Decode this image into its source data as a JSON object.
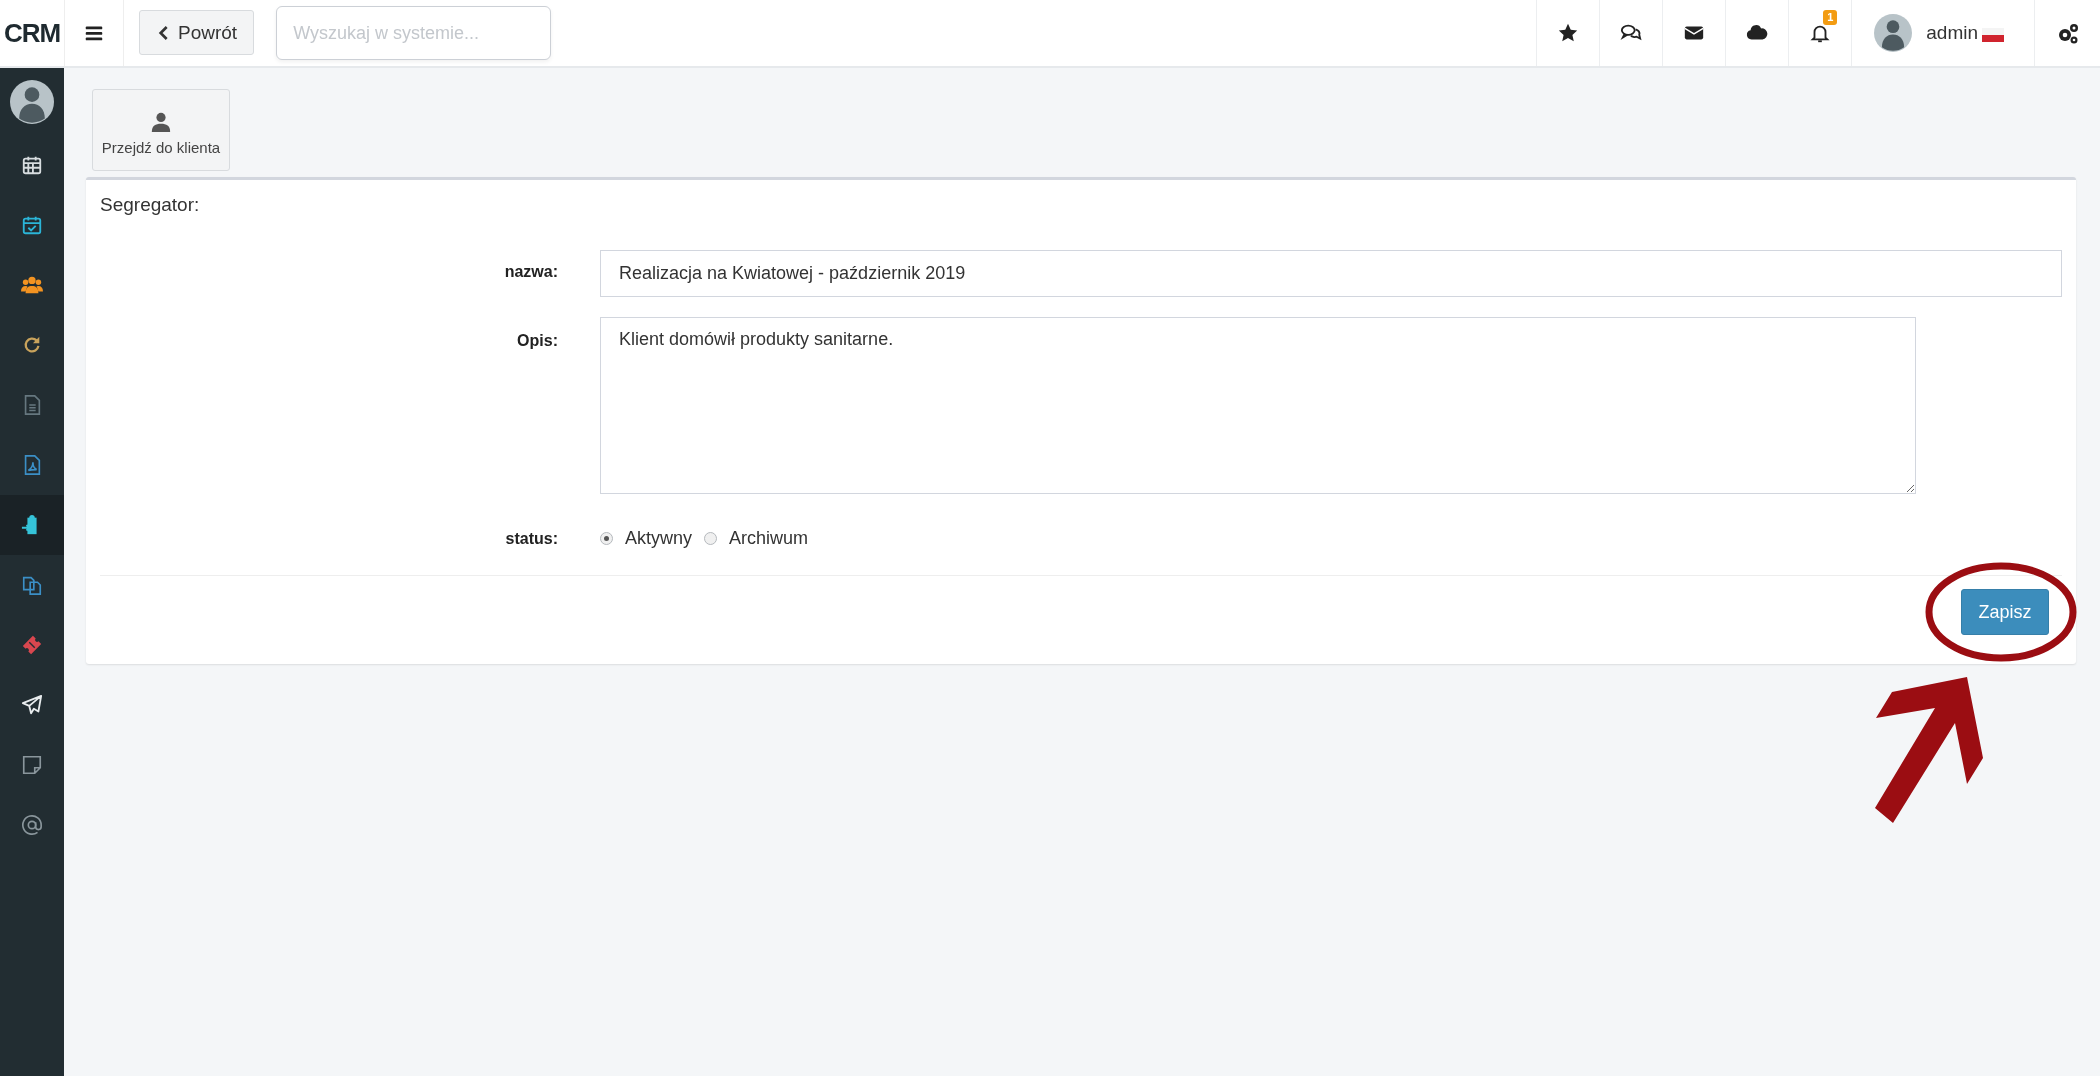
{
  "topbar": {
    "logo": "CRM",
    "back_button": "Powrót",
    "search": {
      "placeholder": "Wyszukaj w systemie..."
    },
    "actions": [
      {
        "kind": "star"
      },
      {
        "kind": "chat"
      },
      {
        "kind": "mail"
      },
      {
        "kind": "cloud"
      },
      {
        "kind": "bell",
        "badge": "1"
      },
      {
        "kind": "user",
        "name": "admin"
      },
      {
        "kind": "gears"
      }
    ]
  },
  "sidebar": {
    "items": [
      {
        "kind": "calendar",
        "color": "#d8dde0",
        "selected": false
      },
      {
        "kind": "calendar-check",
        "color": "#2bb5d8",
        "selected": false
      },
      {
        "kind": "users",
        "color": "#f39321",
        "selected": false
      },
      {
        "kind": "refresh",
        "color": "#c9a35c",
        "selected": false
      },
      {
        "kind": "file",
        "color": "#66777f",
        "selected": false
      },
      {
        "kind": "pdf",
        "color": "#3b8fc6",
        "selected": false
      },
      {
        "kind": "clipboard",
        "color": "#35c4d9",
        "selected": true
      },
      {
        "kind": "copy",
        "color": "#3b8fc6",
        "selected": false
      },
      {
        "kind": "ticket",
        "color": "#d9474f",
        "selected": false
      },
      {
        "kind": "plane",
        "color": "#e8ecee",
        "selected": false
      },
      {
        "kind": "note",
        "color": "#8a969c",
        "selected": false
      },
      {
        "kind": "at",
        "color": "#8a969c",
        "selected": false
      }
    ]
  },
  "toolbar": {
    "buttons": [
      {
        "label": "Przejdź do klienta"
      }
    ]
  },
  "form": {
    "title": "Segregator:",
    "fields": [
      {
        "kind": "text",
        "label": "nazwa:",
        "value": "Realizacja na Kwiatowej - październik 2019"
      },
      {
        "kind": "textarea",
        "label": "Opis:",
        "value": "Klient domówił produkty sanitarne."
      },
      {
        "kind": "radio",
        "label": "status:",
        "options": [
          {
            "label": "Aktywny",
            "selected": true
          },
          {
            "label": "Archiwum",
            "selected": false
          }
        ]
      }
    ],
    "submit": "Zapisz"
  },
  "annotations": [
    {
      "kind": "ellipse"
    },
    {
      "kind": "arrow"
    }
  ]
}
